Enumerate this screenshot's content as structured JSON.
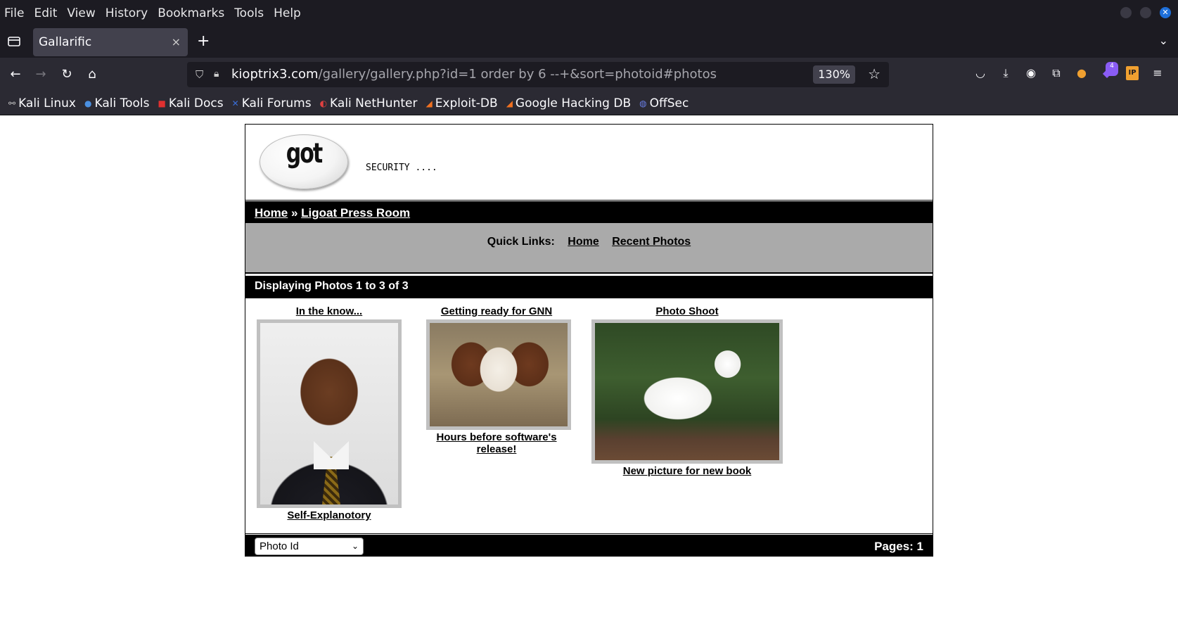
{
  "menu": [
    "File",
    "Edit",
    "View",
    "History",
    "Bookmarks",
    "Tools",
    "Help"
  ],
  "tab": {
    "title": "Gallarific",
    "close": "×",
    "new": "+"
  },
  "urlbar": {
    "host": "kioptrix3.com",
    "path": "/gallery/gallery.php?id=1 order by 6 --+&sort=photoid#photos",
    "zoom": "130%"
  },
  "extensions": {
    "badge": "4",
    "ip_label": "IP"
  },
  "bookmarks": [
    "Kali Linux",
    "Kali Tools",
    "Kali Docs",
    "Kali Forums",
    "Kali NetHunter",
    "Exploit-DB",
    "Google Hacking DB",
    "OffSec"
  ],
  "site": {
    "logo_text": "got goat?",
    "tagline": "SECURITY ....",
    "breadcrumb": {
      "home": "Home",
      "sep": "»",
      "current": "Ligoat Press Room"
    },
    "quicklinks": {
      "label": "Quick Links:",
      "home": "Home",
      "recent": "Recent Photos"
    },
    "count_text": "Displaying Photos 1 to 3 of 3",
    "photos": [
      {
        "title": "In the know...",
        "caption": "Self-Explanotory"
      },
      {
        "title": "Getting ready for GNN",
        "caption": "Hours before software's release!"
      },
      {
        "title": "Photo Shoot",
        "caption": "New picture for new book"
      }
    ],
    "sort_select": "Photo Id",
    "pages": "Pages: 1"
  }
}
